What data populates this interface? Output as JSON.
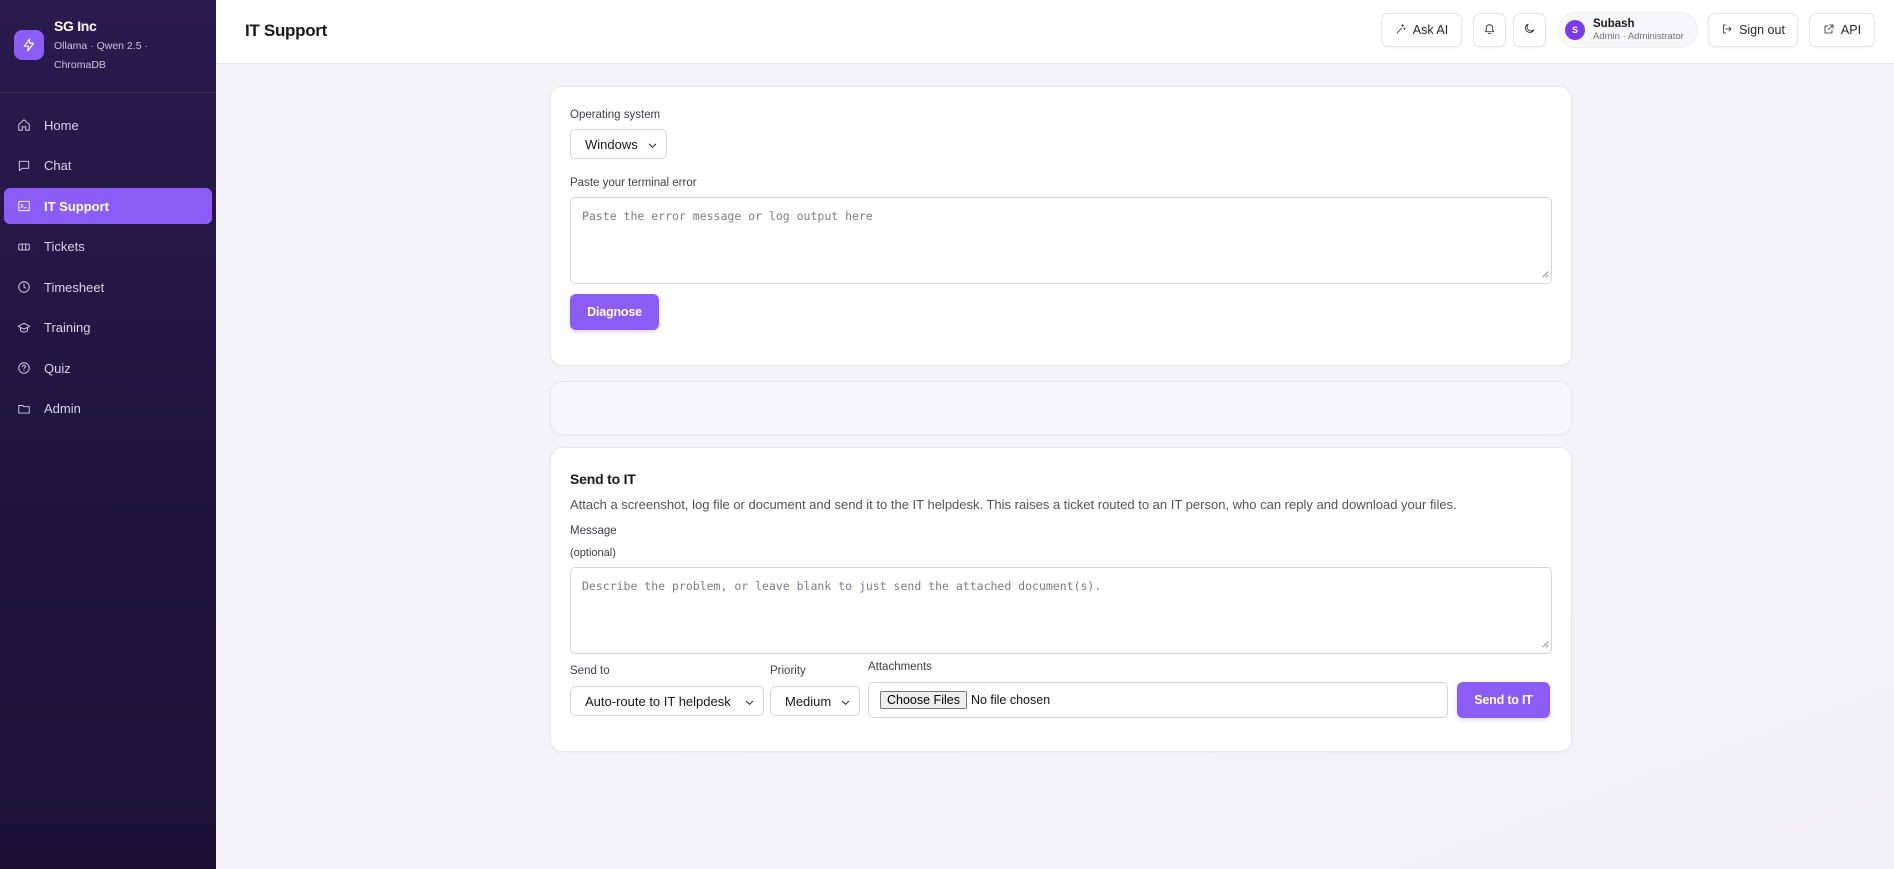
{
  "brand": {
    "name": "SG Inc",
    "subtitle": "Ollama · Qwen 2.5 · ChromaDB",
    "accent": "#8b5cf6"
  },
  "sidebar": {
    "items": [
      {
        "label": "Home",
        "icon": "home-icon"
      },
      {
        "label": "Chat",
        "icon": "chat-icon"
      },
      {
        "label": "IT Support",
        "icon": "terminal-icon",
        "active": true
      },
      {
        "label": "Tickets",
        "icon": "ticket-icon"
      },
      {
        "label": "Timesheet",
        "icon": "clock-icon"
      },
      {
        "label": "Training",
        "icon": "graduation-cap-icon"
      },
      {
        "label": "Quiz",
        "icon": "help-circle-icon"
      },
      {
        "label": "Admin",
        "icon": "folder-icon"
      }
    ]
  },
  "header": {
    "title": "IT Support",
    "ask_ai_label": "Ask AI",
    "user": {
      "initial": "S",
      "name": "Subash",
      "role": "Admin · Administrator"
    },
    "sign_out_label": "Sign out",
    "api_label": "API"
  },
  "diagnose": {
    "os_label": "Operating system",
    "os_value": "Windows",
    "error_label": "Paste your terminal error",
    "error_placeholder": "Paste the error message or log output here",
    "button_label": "Diagnose"
  },
  "send_to_it": {
    "title": "Send to IT",
    "description": "Attach a screenshot, log file or document and send it to the IT helpdesk. This raises a ticket routed to an IT person, who can reply and download your files.",
    "message_label": "Message",
    "message_hint": "(optional)",
    "message_placeholder": "Describe the problem, or leave blank to just send the attached document(s).",
    "send_to_label": "Send to",
    "send_to_value": "Auto-route to IT helpdesk",
    "priority_label": "Priority",
    "priority_value": "Medium",
    "attachments_label": "Attachments",
    "choose_files_label": "Choose Files",
    "file_status": "No file chosen",
    "button_label": "Send to IT"
  }
}
